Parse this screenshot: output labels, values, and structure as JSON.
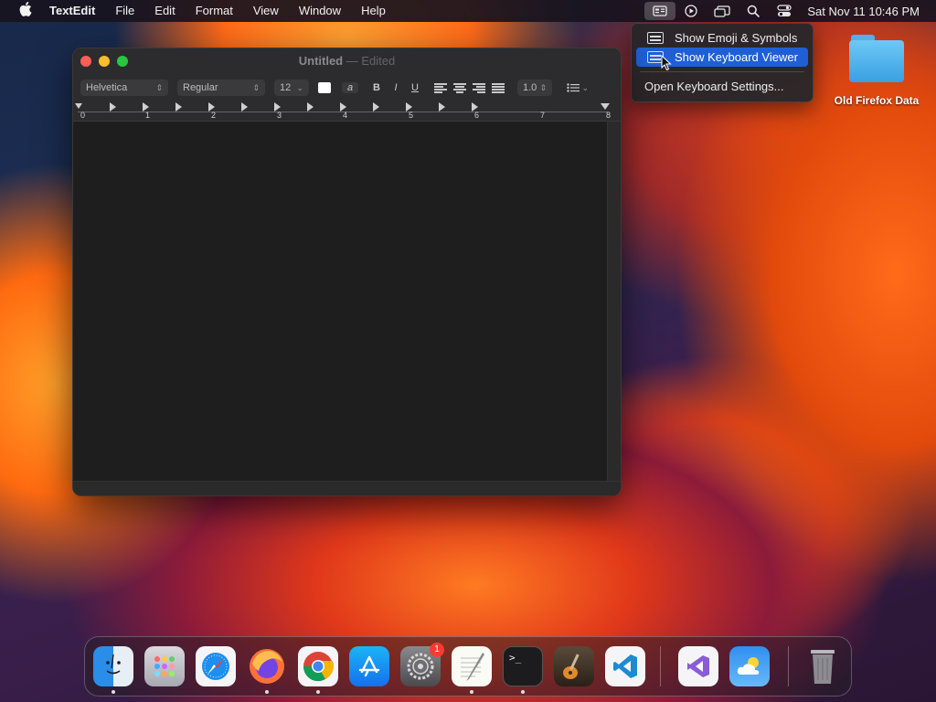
{
  "menubar": {
    "app_name": "TextEdit",
    "menus": [
      "File",
      "Edit",
      "Format",
      "View",
      "Window",
      "Help"
    ],
    "datetime": "Sat Nov 11  10:46 PM",
    "status_icons": [
      "input-menu-icon",
      "play-circle-icon",
      "screen-mirroring-icon",
      "spotlight-search-icon",
      "control-center-icon"
    ]
  },
  "dropdown": {
    "items": [
      {
        "label": "Show Emoji & Symbols",
        "icon": "emoji-symbols-icon",
        "selected": false
      },
      {
        "label": "Show Keyboard Viewer",
        "icon": "keyboard-icon",
        "selected": true
      }
    ],
    "settings_label": "Open Keyboard Settings..."
  },
  "desktop": {
    "folder_label": "Old Firefox Data"
  },
  "window": {
    "title": "Untitled",
    "separator": "—",
    "status": "Edited",
    "toolbar": {
      "font_family": "Helvetica",
      "font_style": "Regular",
      "font_size": "12",
      "bold": "B",
      "italic": "I",
      "underline": "U",
      "strike_glyph": "a",
      "line_spacing": "1.0"
    },
    "ruler_numbers": [
      "0",
      "1",
      "2",
      "3",
      "4",
      "5",
      "6",
      "7",
      "8"
    ]
  },
  "dock": {
    "apps": [
      {
        "name": "Finder",
        "running": true
      },
      {
        "name": "Launchpad",
        "running": false
      },
      {
        "name": "Safari",
        "running": false
      },
      {
        "name": "Firefox",
        "running": true
      },
      {
        "name": "Google Chrome",
        "running": true
      },
      {
        "name": "App Store",
        "running": false
      },
      {
        "name": "System Settings",
        "running": false,
        "badge": "1"
      },
      {
        "name": "TextEdit",
        "running": true
      },
      {
        "name": "Terminal",
        "running": true
      },
      {
        "name": "GarageBand",
        "running": false
      },
      {
        "name": "Visual Studio Code",
        "running": false
      },
      {
        "name": "Visual Studio",
        "running": false
      },
      {
        "name": "Weather",
        "running": false
      },
      {
        "name": "Trash",
        "running": false
      }
    ]
  },
  "colors": {
    "accent": "#1f5fd6",
    "close": "#ff5f57",
    "minimize": "#febc2e",
    "zoom": "#28c840"
  }
}
